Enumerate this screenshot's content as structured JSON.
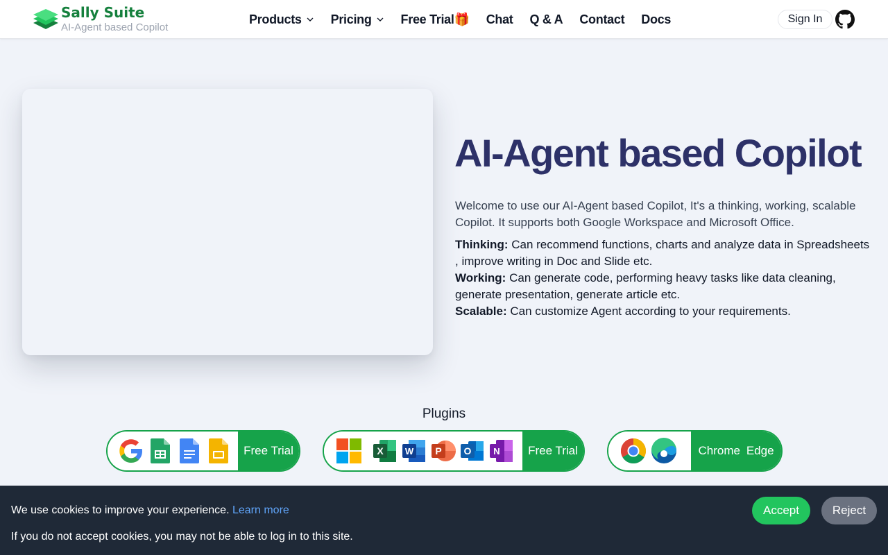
{
  "header": {
    "brand_name": "Sally Suite",
    "brand_tagline": "AI-Agent based Copilot",
    "nav": {
      "products": "Products",
      "pricing": "Pricing",
      "free_trial": "Free Trial🎁",
      "chat": "Chat",
      "qa": "Q & A",
      "contact": "Contact",
      "docs": "Docs"
    },
    "sign_in": "Sign In",
    "github_icon": "github-icon"
  },
  "hero": {
    "title": "AI-Agent based Copilot",
    "intro": "Welcome to use our AI-Agent based Copilot, It's a thinking, working, scalable Copilot. It supports both Google Workspace and Microsoft Office.",
    "points": [
      {
        "label": "Thinking:",
        "text": " Can recommend functions, charts and analyze data in Spreadsheets , improve writing in Doc and Slide etc."
      },
      {
        "label": "Working:",
        "text": " Can generate code, performing heavy tasks like data cleaning, generate presentation, generate article etc."
      },
      {
        "label": "Scalable:",
        "text": " Can customize Agent according to your requirements."
      }
    ]
  },
  "plugins": {
    "title": "Plugins",
    "google": {
      "icons": [
        "google-icon",
        "google-sheets-icon",
        "google-docs-icon",
        "google-slides-icon"
      ],
      "action": "Free Trial"
    },
    "microsoft": {
      "icons": [
        "microsoft-icon",
        "excel-icon",
        "word-icon",
        "powerpoint-icon",
        "outlook-icon",
        "onenote-icon"
      ],
      "action": "Free Trial"
    },
    "browsers": {
      "icons": [
        "chrome-icon",
        "edge-icon"
      ],
      "chrome": "Chrome",
      "edge": "Edge"
    }
  },
  "cookie": {
    "message": "We use cookies to improve your experience. ",
    "learn_more": "Learn more",
    "warning": "If you do not accept cookies, you may not be able to log in to this site.",
    "accept": "Accept",
    "reject": "Reject"
  },
  "colors": {
    "brand_green": "#15803d",
    "action_green": "#16a34a",
    "title_navy": "#2d3168",
    "cookie_bg": "#1f2937"
  }
}
